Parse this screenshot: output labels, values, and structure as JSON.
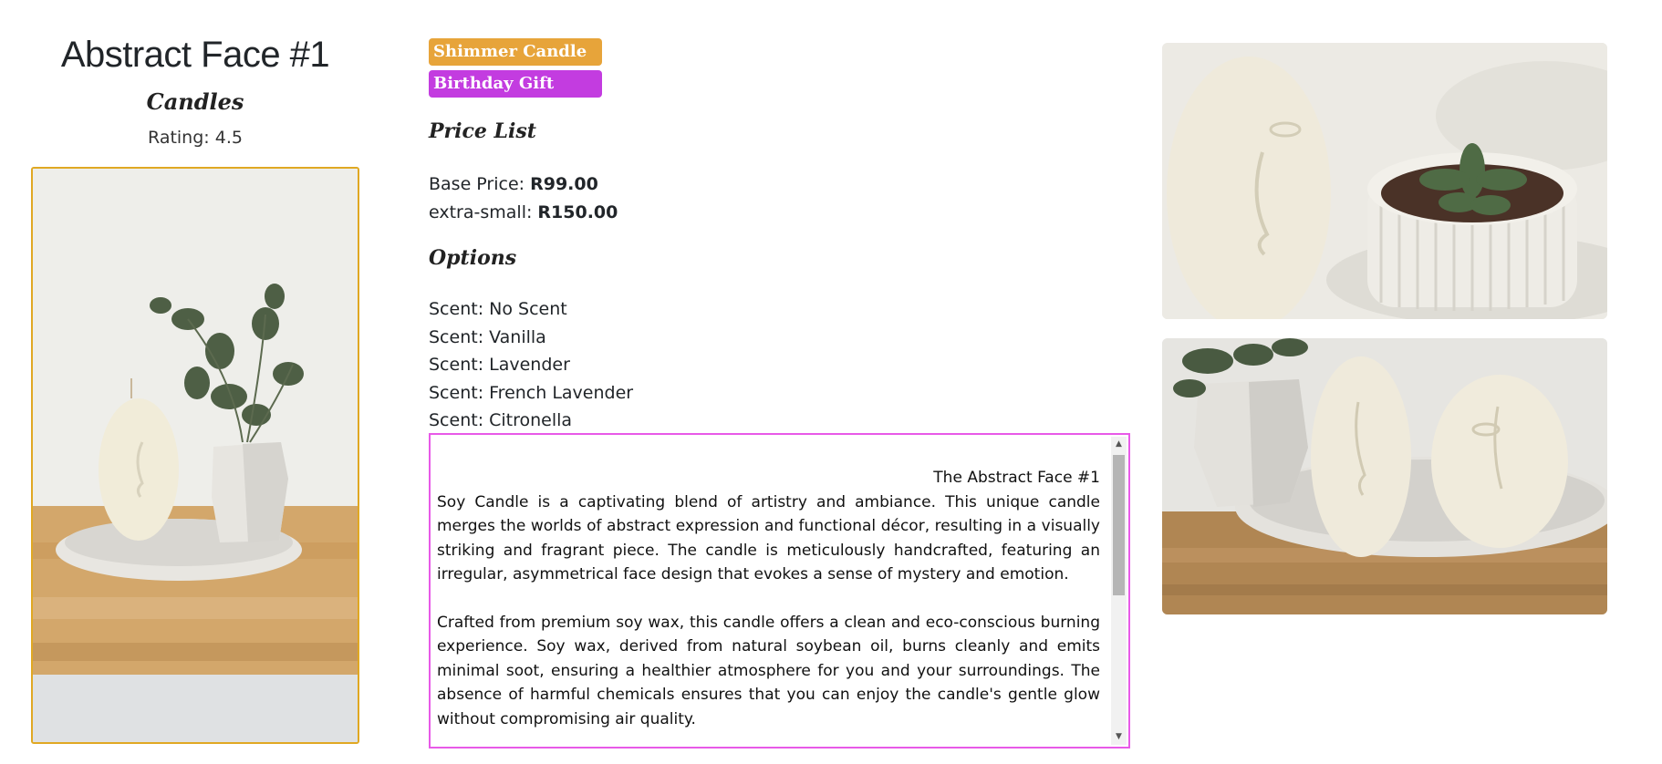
{
  "product": {
    "title": "Abstract Face #1",
    "category": "Candles",
    "rating": "Rating: 4.5"
  },
  "badges": [
    {
      "label": "Shimmer Candle",
      "color": "#e7a43a"
    },
    {
      "label": "Birthday Gift",
      "color": "#c33ce0"
    }
  ],
  "price_list": {
    "heading": "Price List",
    "items": [
      {
        "label": "Base Price:",
        "value": "R99.00"
      },
      {
        "label": "extra-small:",
        "value": "R150.00"
      }
    ]
  },
  "options": {
    "heading": "Options",
    "items": [
      "Scent: No Scent",
      "Scent: Vanilla",
      "Scent: Lavender",
      "Scent: French Lavender",
      "Scent: Citronella"
    ]
  },
  "description": {
    "title": "The Abstract Face #1",
    "paragraphs": [
      "Soy Candle is a captivating blend of artistry and ambiance. This unique candle merges the worlds of abstract expression and functional décor, resulting in a visually striking and fragrant piece. The candle is meticulously handcrafted, featuring an irregular, asymmetrical face design that evokes a sense of mystery and emotion.",
      "Crafted from premium soy wax, this candle offers a clean and eco-conscious burning experience. Soy wax, derived from natural soybean oil, burns cleanly and emits minimal soot, ensuring a healthier atmosphere for you and your surroundings. The absence of harmful chemicals ensures that you can enjoy the candle's gentle glow without compromising air quality."
    ]
  },
  "colors": {
    "main_image_border": "#e0a823",
    "description_border": "#e85ae8"
  },
  "icons": {
    "scroll_up": "scroll-up-arrow-icon",
    "scroll_down": "scroll-down-arrow-icon"
  }
}
